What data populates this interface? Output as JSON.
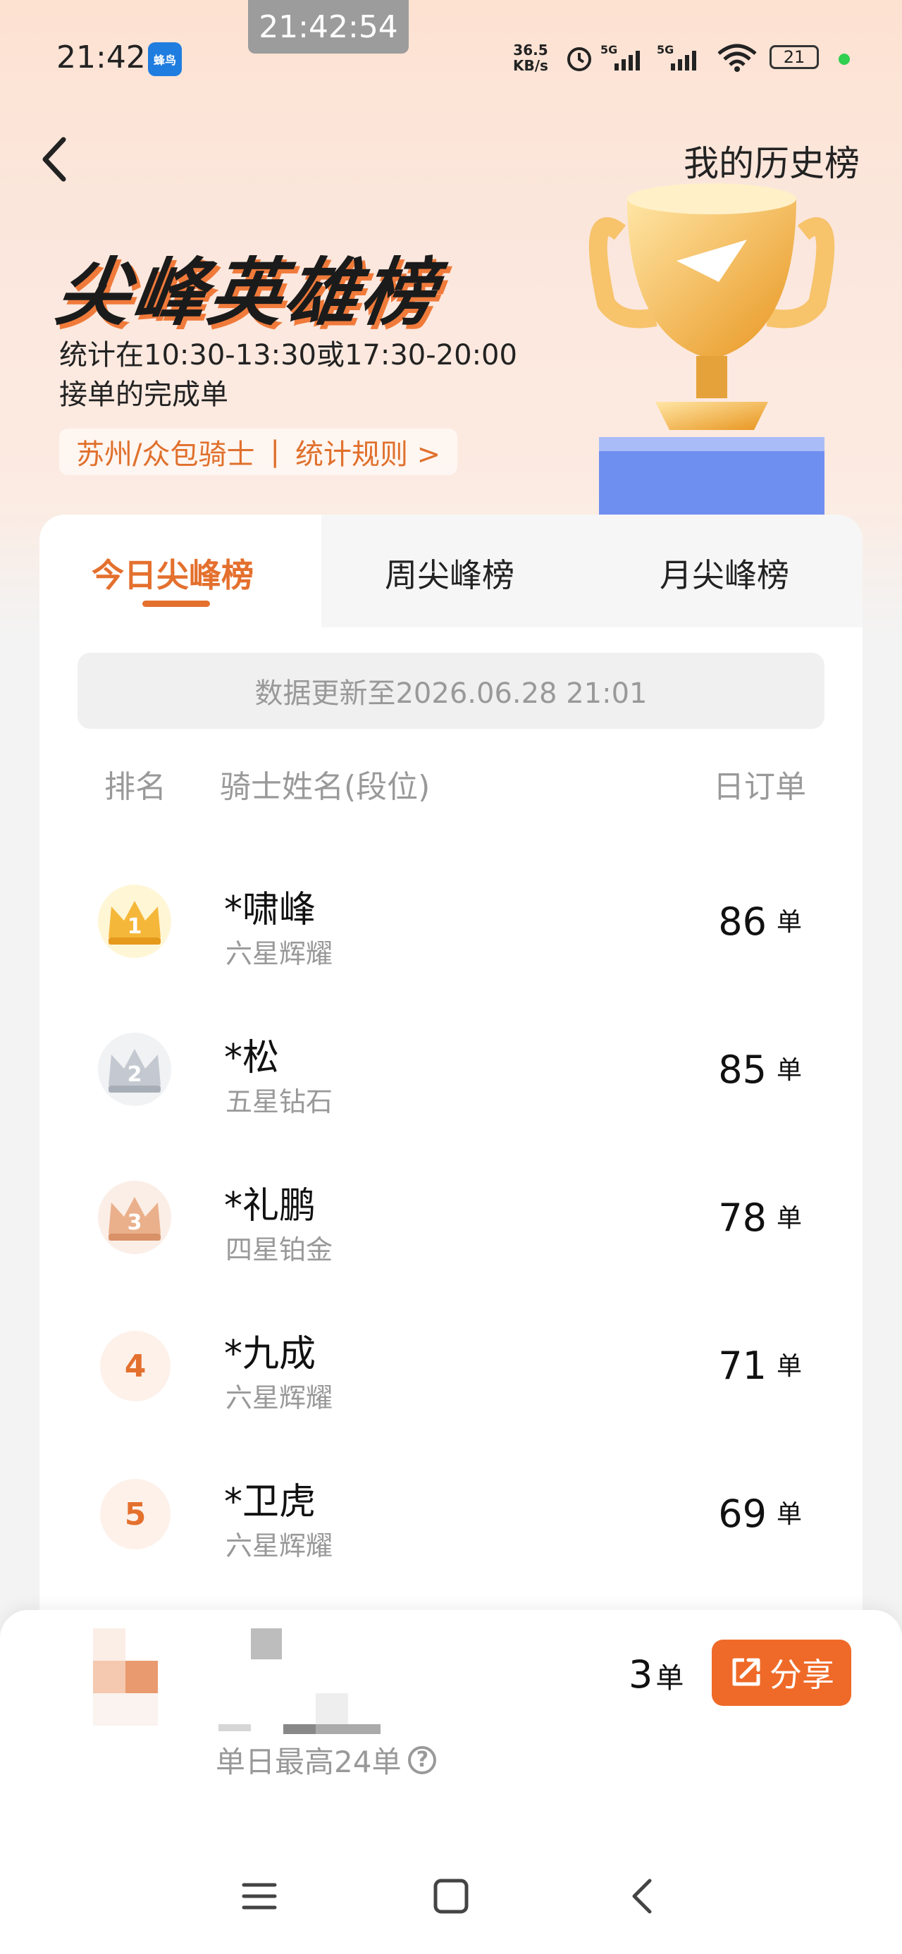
{
  "status_bar": {
    "overlay_time": "21:42:54",
    "time": "21:42",
    "app_badge": "蜂鸟",
    "net_speed_value": "36.5",
    "net_speed_unit": "KB/s",
    "battery": "21"
  },
  "header": {
    "history_link": "我的历史榜",
    "hero_title": "尖峰英雄榜",
    "description": "统计在10:30-13:30或17:30-20:00接单的完成单",
    "city": "苏州/众包骑士",
    "rules_link": "统计规则 >"
  },
  "tabs": [
    {
      "label": "今日尖峰榜",
      "active": true
    },
    {
      "label": "周尖峰榜",
      "active": false
    },
    {
      "label": "月尖峰榜",
      "active": false
    }
  ],
  "update_notice": "数据更新至2026.06.28 21:01",
  "columns": {
    "rank": "排名",
    "name": "骑士姓名(段位)",
    "orders": "日订单"
  },
  "ranking": [
    {
      "rank": "1",
      "name": "*啸峰",
      "level": "六星辉耀",
      "orders": "86",
      "unit": "单"
    },
    {
      "rank": "2",
      "name": "*松",
      "level": "五星钻石",
      "orders": "85",
      "unit": "单"
    },
    {
      "rank": "3",
      "name": "*礼鹏",
      "level": "四星铂金",
      "orders": "78",
      "unit": "单"
    },
    {
      "rank": "4",
      "name": "*九成",
      "level": "六星辉耀",
      "orders": "71",
      "unit": "单"
    },
    {
      "rank": "5",
      "name": "*卫虎",
      "level": "六星辉耀",
      "orders": "69",
      "unit": "单"
    }
  ],
  "my_stats": {
    "orders": "3",
    "unit": "单",
    "best": "单日最高24单",
    "share": "分享"
  },
  "colors": {
    "accent": "#e4702e",
    "share": "#ef6a28",
    "gold": "#f5b73a"
  }
}
